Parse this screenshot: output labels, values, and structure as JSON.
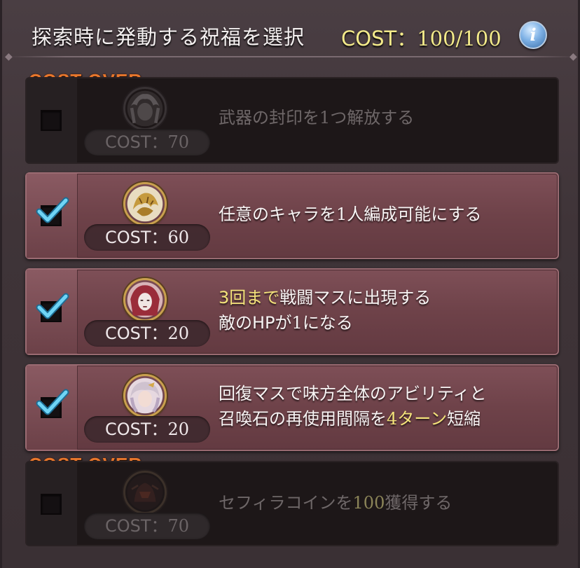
{
  "header": {
    "title": "探索時に発動する祝福を選択",
    "cost_label": "COST：",
    "cost_value": "100/100",
    "info_icon": "info-icon",
    "info_glyph": "i"
  },
  "cost_over_label": "COST OVER",
  "blessings": [
    {
      "checked": false,
      "disabled": true,
      "cost_over": true,
      "portrait_icon": "silver-haired-character-portrait",
      "cost_label": "COST：",
      "cost_value": "70",
      "line1_pre": "武器の封印を",
      "line1_num": "1",
      "line1_post": "つ解放する"
    },
    {
      "checked": true,
      "disabled": false,
      "cost_over": false,
      "portrait_icon": "golden-beast-portrait",
      "cost_label": "COST：",
      "cost_value": "60",
      "line1_pre": "任意のキャラを",
      "line1_num": "1",
      "line1_post": "人編成可能にする"
    },
    {
      "checked": true,
      "disabled": false,
      "cost_over": false,
      "portrait_icon": "masked-red-character-portrait",
      "cost_label": "COST：",
      "cost_value": "20",
      "line1_hl": "3回まで",
      "line1_post": "戦闘マスに出現する",
      "line2_pre": "敵のHPが",
      "line2_num": "1",
      "line2_post": "になる"
    },
    {
      "checked": true,
      "disabled": false,
      "cost_over": false,
      "portrait_icon": "white-haired-character-portrait",
      "cost_label": "COST：",
      "cost_value": "20",
      "line1": "回復マスで味方全体のアビリティと",
      "line2_pre": "召喚石の再使用間隔を",
      "line2_hl": "4ターン",
      "line2_post": "短縮"
    },
    {
      "checked": false,
      "disabled": true,
      "cost_over": true,
      "portrait_icon": "dark-armored-character-portrait",
      "cost_label": "COST：",
      "cost_value": "70",
      "line1_pre": "セフィラコインを",
      "line1_hl": "100",
      "line1_post": "獲得する"
    }
  ],
  "colors": {
    "accent_yellow": "#f3ea8a",
    "cost_over_orange": "#e8772c",
    "check_blue": "#5ec8f0",
    "active_row": "#7e4f57",
    "disabled_row": "#1d1718"
  }
}
